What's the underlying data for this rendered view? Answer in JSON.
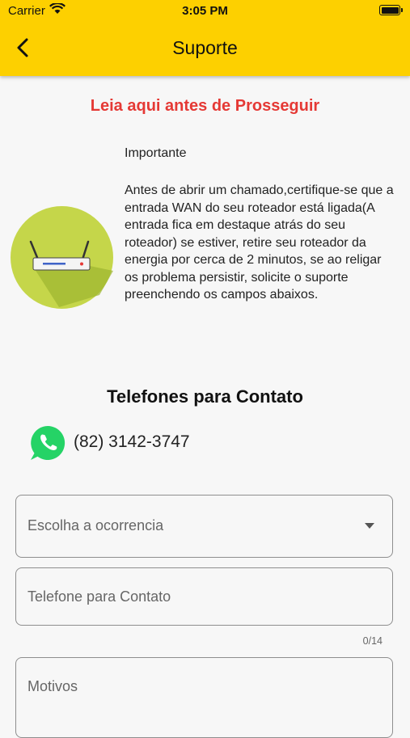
{
  "status_bar": {
    "carrier": "Carrier",
    "time": "3:05 PM"
  },
  "header": {
    "title": "Suporte",
    "back_icon": "chevron-left-icon",
    "background_color": "#fdd000"
  },
  "notice": {
    "heading": "Leia aqui antes de Prosseguir",
    "heading_color": "#e53935",
    "important_label": "Importante",
    "body": "Antes de abrir um chamado,certifique-se que a entrada WAN do seu roteador está ligada(A entrada fica em destaque atrás do seu roteador) se estiver, retire seu roteador da energia por cerca de 2 minutos, se ao religar os problema persistir, solicite o suporte preenchendo os campos abaixos.",
    "image_icon": "router-icon"
  },
  "contacts": {
    "title": "Telefones para Contato",
    "items": [
      {
        "icon": "whatsapp-icon",
        "number": "(82) 3142-3747"
      }
    ]
  },
  "form": {
    "occurrence_select": {
      "placeholder": "Escolha a ocorrencia"
    },
    "phone_field": {
      "placeholder": "Telefone para Contato",
      "counter": "0/14"
    },
    "reasons_field": {
      "placeholder": "Motivos"
    }
  }
}
